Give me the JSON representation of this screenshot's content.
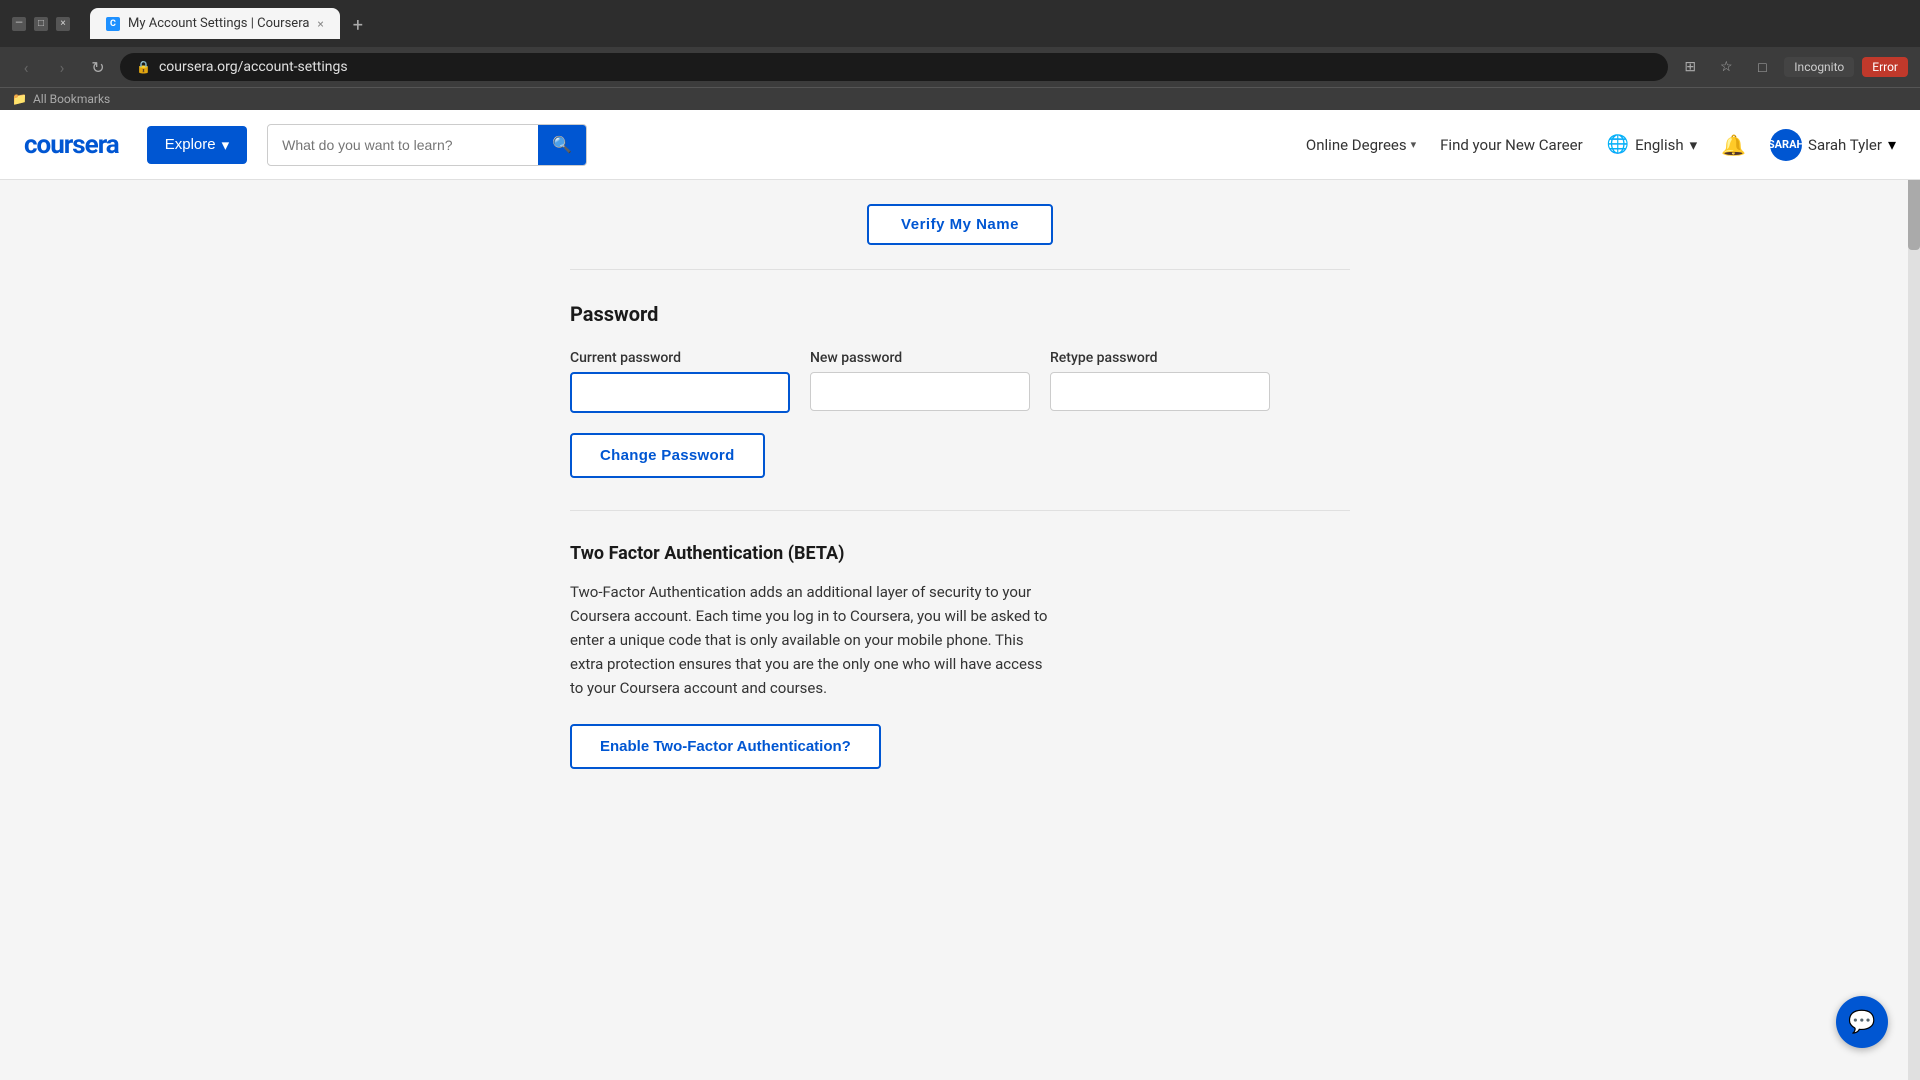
{
  "browser": {
    "tab_favicon": "C",
    "tab_title": "My Account Settings | Coursera",
    "tab_close": "×",
    "tab_new": "+",
    "url": "coursera.org/account-settings",
    "nav_back": "‹",
    "nav_forward": "›",
    "nav_refresh": "↻",
    "lock_icon": "🔒",
    "incognito_label": "Incognito",
    "error_label": "Error",
    "bookmarks_label": "All Bookmarks"
  },
  "navbar": {
    "logo": "coursera",
    "explore_label": "Explore",
    "explore_chevron": "▾",
    "search_placeholder": "What do you want to learn?",
    "online_degrees_label": "Online Degrees",
    "online_degrees_chevron": "▾",
    "find_career_label": "Find your New Career",
    "language_label": "English",
    "language_chevron": "▾",
    "user_initials": "SARAH",
    "user_name": "Sarah Tyler",
    "user_chevron": "▾"
  },
  "verify_section": {
    "button_label": "Verify My Name"
  },
  "password_section": {
    "title": "Password",
    "current_password_label": "Current password",
    "current_password_placeholder": "",
    "new_password_label": "New password",
    "new_password_placeholder": "",
    "retype_password_label": "Retype password",
    "retype_password_placeholder": "",
    "change_button_label": "Change Password"
  },
  "tfa_section": {
    "title": "Two Factor Authentication (BETA)",
    "description": "Two-Factor Authentication adds an additional layer of security to your Coursera account. Each time you log in to Coursera, you will be asked to enter a unique code that is only available on your mobile phone. This extra protection ensures that you are the only one who will have access to your Coursera account and courses.",
    "enable_button_label": "Enable Two-Factor Authentication?"
  },
  "chat": {
    "icon": "💬"
  }
}
